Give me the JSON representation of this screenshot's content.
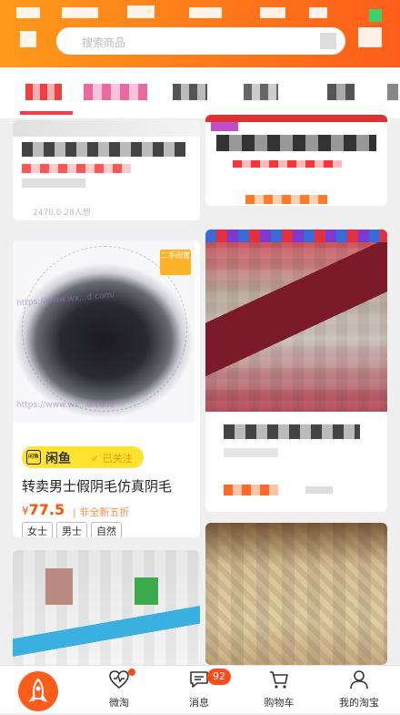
{
  "search": {
    "placeholder": "搜索商品"
  },
  "product": {
    "likes": "2470.0 28人想",
    "badge": "二手闲置",
    "watermark": "https://www.wx...d.com/",
    "platform": "闲鱼",
    "follow_status": "已关注",
    "title": "转卖男士假阴毛仿真阴毛",
    "currency": "¥",
    "price": "77.5",
    "condition": "非全新五折",
    "tags": [
      "女士",
      "男士",
      "自然"
    ]
  },
  "nav": {
    "items": [
      {
        "label": "微淘",
        "icon": "heart-wave-icon"
      },
      {
        "label": "消息",
        "icon": "chat-bubble-icon"
      },
      {
        "label": "购物车",
        "icon": "cart-icon"
      },
      {
        "label": "我的淘宝",
        "icon": "person-icon"
      }
    ],
    "message_count": "92"
  },
  "colors": {
    "brand_orange": "#ff5e1a",
    "xianyu_yellow": "#ffe32e",
    "price_orange": "#ff5000"
  }
}
